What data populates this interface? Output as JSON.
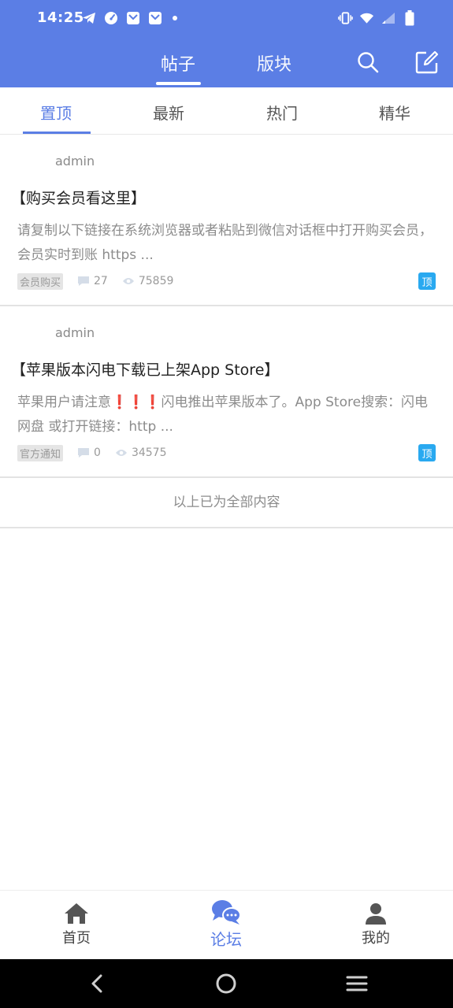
{
  "status_bar": {
    "time": "14:25",
    "left_icons": [
      "telegram-icon",
      "speed-icon",
      "mail-icon",
      "mail-icon"
    ],
    "right_icons": [
      "vibrate-icon",
      "wifi-icon",
      "signal-icon",
      "battery-icon"
    ]
  },
  "top_nav": {
    "tabs": [
      {
        "label": "帖子",
        "active": true
      },
      {
        "label": "版块",
        "active": false
      }
    ],
    "actions": [
      "search-icon",
      "edit-icon"
    ]
  },
  "sub_tabs": [
    {
      "label": "置顶",
      "active": true
    },
    {
      "label": "最新",
      "active": false
    },
    {
      "label": "热门",
      "active": false
    },
    {
      "label": "精华",
      "active": false
    }
  ],
  "posts": [
    {
      "author": "admin",
      "title": "【购买会员看这里】",
      "excerpt": "请复制以下链接在系统浏览器或者粘贴到微信对话框中打开购买会员，会员实时到账 https ...",
      "tag": "会员购买",
      "comments": "27",
      "views": "75859",
      "pin_label": "顶"
    },
    {
      "author": "admin",
      "title": "【苹果版本闪电下载已上架App Store】",
      "excerpt_before": "苹果用户请注意",
      "excerpt_marks": "❗❗❗",
      "excerpt_after": "闪电推出苹果版本了。App Store搜索：闪电网盘 或打开链接：http ...",
      "tag": "官方通知",
      "comments": "0",
      "views": "34575",
      "pin_label": "顶"
    }
  ],
  "end_note": "以上已为全部内容",
  "bottom_nav": [
    {
      "label": "首页",
      "icon": "home-icon",
      "active": false
    },
    {
      "label": "论坛",
      "icon": "chat-bubbles-icon",
      "active": true
    },
    {
      "label": "我的",
      "icon": "user-icon",
      "active": false
    }
  ],
  "colors": {
    "primary": "#5b7ee5",
    "pin_badge": "#29a9f0",
    "alert_red": "#e53935"
  }
}
